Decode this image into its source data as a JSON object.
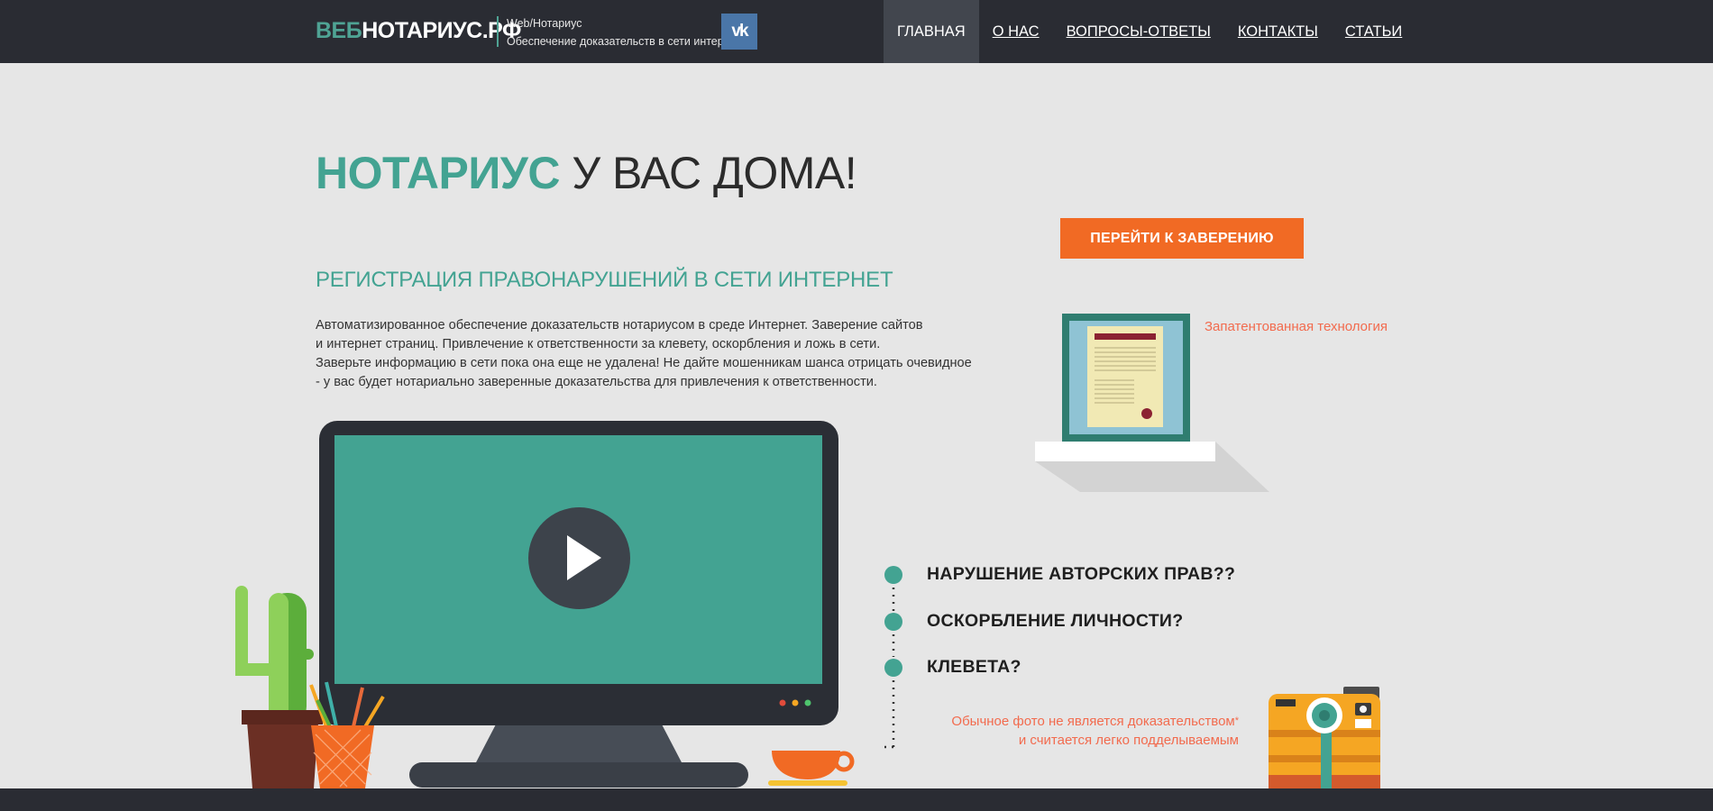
{
  "header": {
    "logo_part1": "ВЕБ",
    "logo_part2": "НОТАРИУС.РФ",
    "tagline_line1": "Web/Нотариус",
    "tagline_line2": "Обеспечение доказательств в сети интернет",
    "vk_icon": "vk-logo",
    "nav": [
      {
        "label": "ГЛАВНАЯ",
        "active": true
      },
      {
        "label": "О НАС"
      },
      {
        "label": "ВОПРОСЫ-ОТВЕТЫ"
      },
      {
        "label": "КОНТАКТЫ"
      },
      {
        "label": "СТАТЬИ"
      }
    ]
  },
  "hero": {
    "title_highlight": "НОТАРИУС",
    "title_rest": " У ВАС ДОМА!",
    "cta_label": "ПЕРЕЙТИ К ЗАВЕРЕНИЮ",
    "subtitle": "РЕГИСТРАЦИЯ ПРАВОНАРУШЕНИЙ В СЕТИ ИНТЕРНЕТ",
    "description": [
      "Автоматизированное обеспечение доказательств нотариусом в среде Интернет. Заверение сайтов",
      "и интернет страниц. Привлечение к ответственности за клевету, оскорбления и ложь в сети.",
      "Заверьте информацию в сети пока она еще не удалена! Не дайте мошенникам шанса отрицать очевидное",
      "- у вас будет нотариально заверенные доказательства для привлечения к ответственности."
    ],
    "patent_label": "Запатентованная технология"
  },
  "questions": [
    "НАРУШЕНИЕ АВТОРСКИХ ПРАВ??",
    "ОСКОРБЛЕНИЕ ЛИЧНОСТИ?",
    "КЛЕВЕТА?"
  ],
  "note": {
    "line1": "Обычное фото не является доказательством",
    "star": "*",
    "line2": "и считается легко подделываемым"
  },
  "colors": {
    "accent": "#43a392",
    "cta": "#f16a24",
    "dark": "#2a2c33",
    "note": "#f26b4e"
  }
}
